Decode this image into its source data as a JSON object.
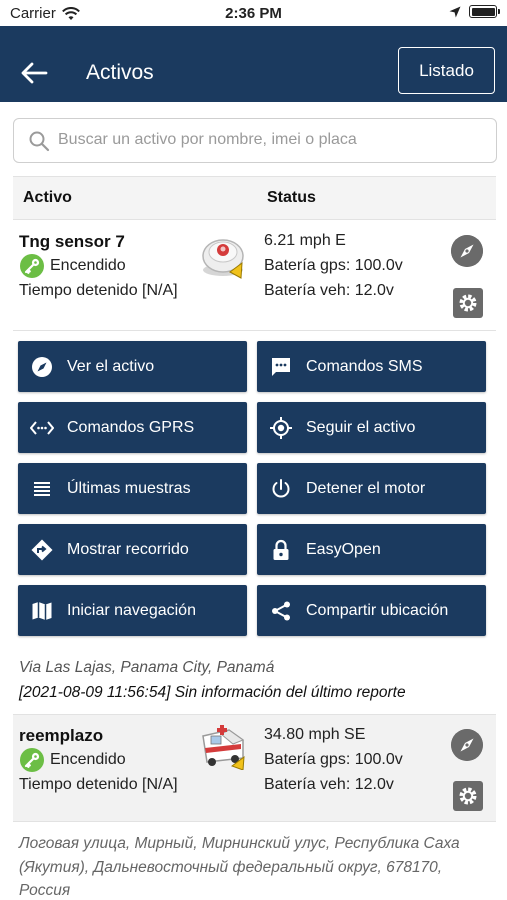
{
  "status_bar": {
    "carrier": "Carrier",
    "time": "2:36 PM"
  },
  "header": {
    "title": "Activos",
    "list_button": "Listado",
    "bg_color": "#1b3a5f"
  },
  "search": {
    "placeholder": "Buscar un activo por nombre, imei o placa",
    "value": ""
  },
  "table": {
    "col_asset": "Activo",
    "col_status": "Status"
  },
  "assets": [
    {
      "name": "Tng sensor 7",
      "state": "Encendido",
      "stopped": "Tiempo detenido [N/A]",
      "speed": "6.21 mph E",
      "gps_battery": "Batería gps: 100.0v",
      "vehicle_battery": "Batería veh: 12.0v",
      "address": "Via Las Lajas, Panama City, Panamá",
      "last_report": "[2021-08-09 11:56:54] Sin información del último reporte",
      "icon": "sensor-device-icon"
    },
    {
      "name": "reemplazo",
      "state": "Encendido",
      "stopped": "Tiempo detenido [N/A]",
      "speed": "34.80 mph SE",
      "gps_battery": "Batería gps: 100.0v",
      "vehicle_battery": "Batería veh: 12.0v",
      "address": "Логовая улица, Мирный, Мирнинский улус, Республика Саха (Якутия), Дальневосточный федеральный округ, 678170, Россия",
      "icon": "ambulance-icon"
    }
  ],
  "actions": {
    "view": "Ver el activo",
    "sms": "Comandos SMS",
    "gprs": "Comandos GPRS",
    "follow": "Seguir el activo",
    "samples": "Últimas muestras",
    "stop_engine": "Detener el motor",
    "route": "Mostrar recorrido",
    "easyopen": "EasyOpen",
    "navigation": "Iniciar navegación",
    "share": "Compartir ubicación"
  }
}
